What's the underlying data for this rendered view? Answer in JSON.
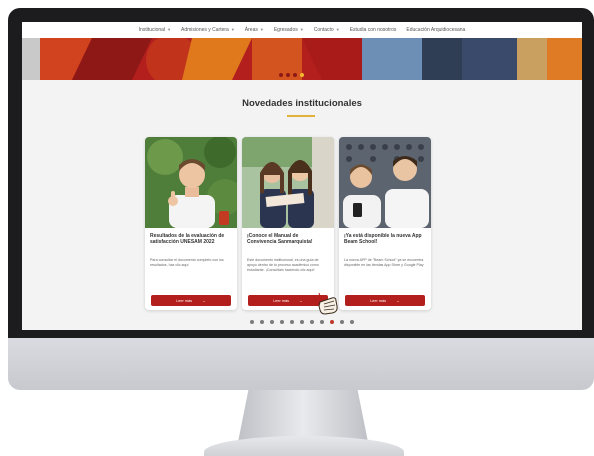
{
  "nav": {
    "items": [
      {
        "label": "Institucional",
        "has_caret": true
      },
      {
        "label": "Admisiones y Cartera",
        "has_caret": true
      },
      {
        "label": "Áreas",
        "has_caret": true
      },
      {
        "label": "Egresados",
        "has_caret": true
      },
      {
        "label": "Contacto",
        "has_caret": true
      },
      {
        "label": "Estudia con nosotros",
        "has_caret": false
      },
      {
        "label": "Educación Arquidiocesana",
        "has_caret": false
      }
    ]
  },
  "hero": {
    "slide_count": 4,
    "active_slide": 3,
    "colors": {
      "red": "#b31f1d",
      "orange": "#e0781c",
      "dark_red": "#7d1512"
    }
  },
  "section": {
    "title": "Novedades institucionales",
    "rule_color": "#e3b23c"
  },
  "cards": [
    {
      "image": "photo-student-thumbs-up",
      "title": "Resultados de la evaluación de satisfacción UNESAM 2022",
      "text": "Para consultar el documento completo con los resultados, haz clic aquí",
      "button_label": "Leer más",
      "button_icon": "arrow-right-icon"
    },
    {
      "image": "photo-students-reading",
      "title": "¡Conoce el Manual de Convivencia Sanmarquista!",
      "text": "Este documento institucional, es una guía de apoyo dentro de tu proceso académico como estudiante. ¡Consúltalo haciendo clic aquí!",
      "button_label": "Leer más",
      "button_icon": "arrow-right-icon"
    },
    {
      "image": "photo-students-phone",
      "title": "¡Ya está disponible la nueva App Beam School!",
      "text": "La nueva APP de \"Beam School\" ya se encuentra disponible en las tiendas App Store y Google Play",
      "button_label": "Leer más",
      "button_icon": "arrow-right-icon"
    }
  ],
  "carousel": {
    "dot_count": 11,
    "active_index": 8
  },
  "cursor": "pointer-hand-icon",
  "colors": {
    "accent": "#b31f1d",
    "bezel": "#1c1c1e",
    "screen_bg": "#f3f3f4"
  }
}
